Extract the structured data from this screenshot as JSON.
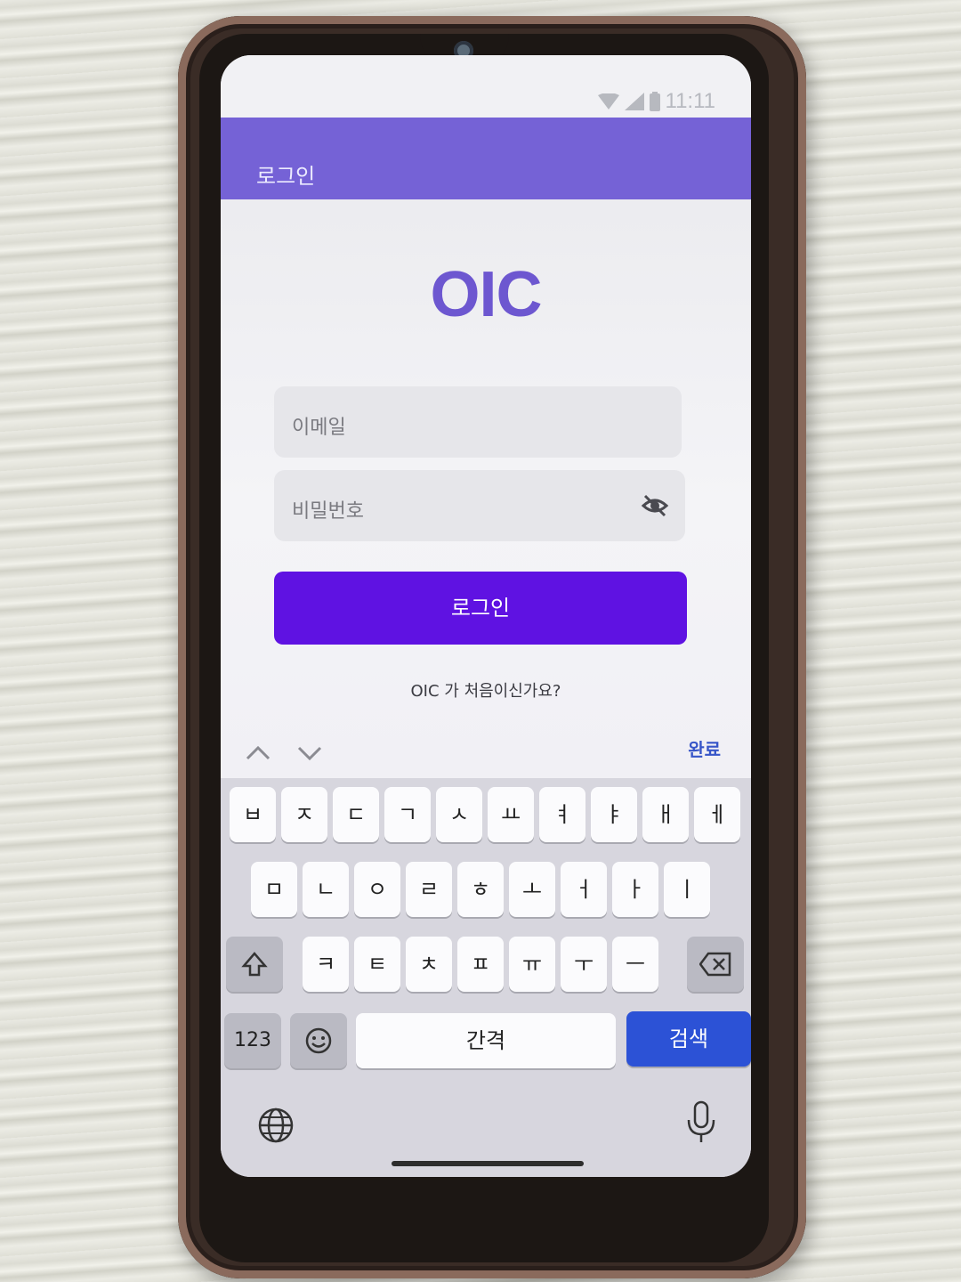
{
  "statusbar": {
    "time": "11:11"
  },
  "appbar": {
    "title": "로그인"
  },
  "logo": {
    "text": "OIC"
  },
  "form": {
    "email_placeholder": "이메일",
    "password_placeholder": "비밀번호",
    "login_label": "로그인",
    "signup_prompt": "OIC 가 처음이신가요?"
  },
  "keyboard": {
    "done_label": "완료",
    "row1": [
      "ㅂ",
      "ㅈ",
      "ㄷ",
      "ㄱ",
      "ㅅ",
      "ㅛ",
      "ㅕ",
      "ㅑ",
      "ㅐ",
      "ㅔ"
    ],
    "row2": [
      "ㅁ",
      "ㄴ",
      "ㅇ",
      "ㄹ",
      "ㅎ",
      "ㅗ",
      "ㅓ",
      "ㅏ",
      "ㅣ"
    ],
    "row3": [
      "ㅋ",
      "ㅌ",
      "ㅊ",
      "ㅍ",
      "ㅠ",
      "ㅜ",
      "ㅡ"
    ],
    "numbers_label": "123",
    "space_label": "간격",
    "search_label": "검색"
  },
  "colors": {
    "appbar": "#7562d6",
    "primary": "#5f12e2",
    "logo": "#6d57d0",
    "search_key": "#2c52d6"
  }
}
